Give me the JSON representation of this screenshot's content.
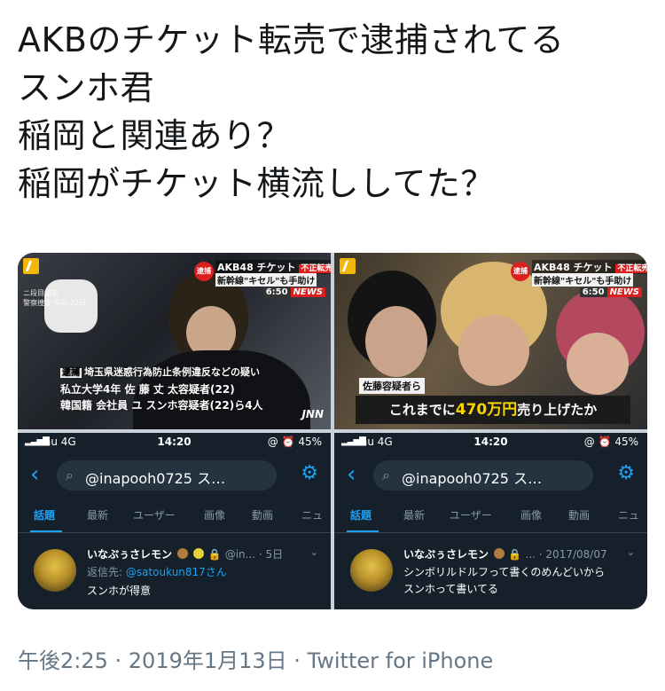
{
  "tweet": {
    "lines": [
      "AKBのチケット転売で逮捕されてる",
      "スンホ君",
      "稲岡と関連あり？",
      "稲岡がチケット横流ししてた？"
    ],
    "timestamp": "午後2:25 · 2019年1月13日 · Twitter for iPhone"
  },
  "news_left": {
    "badge": "逮捕",
    "line1": "AKB48 チケット",
    "tag": "不正転売",
    "line2": "新幹線\"キセル\"も手助け",
    "time": "6:50",
    "news": "NEWS",
    "small": [
      "ニ段目撮影",
      "警察捜査 保存 22日"
    ],
    "caption_tag": "逮捕",
    "caption_line1": "埼玉県迷惑行為防止条例違反などの疑い",
    "caption_line2": "私立大学4年 佐 藤 丈 太容疑者(22)",
    "caption_line3": "韓国籍 会社員 ユ スンホ容疑者(22)ら4人",
    "network": "JNN"
  },
  "news_right": {
    "badge": "逮捕",
    "line1": "AKB48 チケット",
    "tag": "不正転売",
    "line2": "新幹線\"キセル\"も手助け",
    "time": "6:50",
    "news": "NEWS",
    "caption_small": "佐藤容疑者ら",
    "caption_pre": "これまでに",
    "caption_hl": "470万円",
    "caption_post": "売り上げたか"
  },
  "phone_left": {
    "signal": "▂▃▅▇",
    "carrier": "au  4G",
    "clock": "14:20",
    "right": "@ ⏰ 45%",
    "query": "@inapooh0725 ス…",
    "tabs": [
      "話題",
      "最新",
      "ユーザー",
      "画像",
      "動画",
      "ニュ"
    ],
    "author": "いなぷぅさレモン",
    "meta": "@in... · 5日",
    "reply_label": "返信先: ",
    "reply_at": "@satoukun817さん",
    "body": "スンホが得意"
  },
  "phone_right": {
    "signal": "▂▃▅▇",
    "carrier": "au  4G",
    "clock": "14:20",
    "right": "@ ⏰ 45%",
    "query": "@inapooh0725 ス…",
    "tabs": [
      "話題",
      "最新",
      "ユーザー",
      "画像",
      "動画",
      "ニュ"
    ],
    "author": "いなぷぅさレモン",
    "meta": "... · 2017/08/07",
    "body1": "シンボリルドルフって書くのめんどいから",
    "body2": "スンホって書いてる"
  },
  "colors": {
    "twitter_blue": "#1da1f2",
    "dark_bg": "#15202b",
    "news_red": "#d9201e",
    "caption_yellow": "#f5d400"
  }
}
